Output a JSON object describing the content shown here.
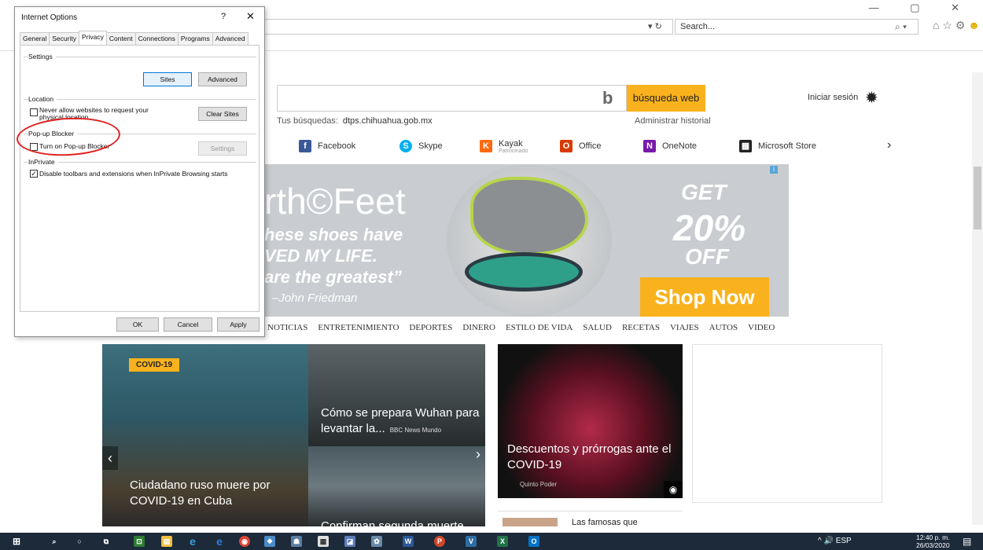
{
  "browser": {
    "search_placeholder": "Search...",
    "addr_tools": "▾ ↻",
    "window_controls": "— ▢ ✕"
  },
  "dialog": {
    "title": "Internet Options",
    "help": "?",
    "close": "✕",
    "tabs": [
      "General",
      "Security",
      "Privacy",
      "Content",
      "Connections",
      "Programs",
      "Advanced"
    ],
    "active_tab": "Privacy",
    "settings_label": "Settings",
    "sites_button": "Sites",
    "advanced_button": "Advanced",
    "location_label": "Location",
    "location_checkbox": "Never allow websites to request your physical location",
    "location_checked": false,
    "clear_sites_button": "Clear Sites",
    "popup_label": "Pop-up Blocker",
    "popup_checkbox": "Turn on Pop-up Blocker",
    "popup_checked": false,
    "popup_settings_button": "Settings",
    "inprivate_label": "InPrivate",
    "inprivate_checkbox": "Disable toolbars and extensions when InPrivate Browsing starts",
    "inprivate_checked": true,
    "ok_button": "OK",
    "cancel_button": "Cancel",
    "apply_button": "Apply"
  },
  "bing": {
    "search_button": "búsqueda web",
    "sign_in": "Iniciar sesión",
    "recent_label": "Tus búsquedas:",
    "recent_query": "dtps.chihuahua.gob.mx",
    "history_link": "Administrar historial"
  },
  "quick_links": [
    {
      "label": "Facebook",
      "sub": "",
      "icon": "f",
      "color": "#3b5998"
    },
    {
      "label": "Skype",
      "sub": "",
      "icon": "S",
      "color": "#00aff0"
    },
    {
      "label": "Kayak",
      "sub": "Patrocinado",
      "icon": "K",
      "color": "#ff690f"
    },
    {
      "label": "Office",
      "sub": "",
      "icon": "O",
      "color": "#d83b01"
    },
    {
      "label": "OneNote",
      "sub": "",
      "icon": "N",
      "color": "#7719aa"
    },
    {
      "label": "Microsoft Store",
      "sub": "",
      "icon": "▦",
      "color": "#222222"
    }
  ],
  "ad": {
    "brand": "rth©Feet",
    "quote_line1": "hese shoes have",
    "quote_line2": "VED MY LIFE.",
    "quote_line3": "are the greatest”",
    "signature": "–John Friedman",
    "get": "GET",
    "percent": "20%",
    "off": "OFF",
    "shop": "Shop Now",
    "info": "i"
  },
  "categories": [
    "NOTICIAS",
    "ENTRETENIMIENTO",
    "DEPORTES",
    "DINERO",
    "ESTILO DE VIDA",
    "SALUD",
    "RECETAS",
    "VIAJES",
    "AUTOS",
    "VIDEO"
  ],
  "news": {
    "t1_badge": "COVID-19",
    "t1_caption": "Ciudadano ruso muere por COVID-19 en Cuba",
    "t2_caption": "Cómo se prepara Wuhan para levantar la...",
    "t2_source": "BBC News Mundo",
    "t3_caption": "Confirman segunda muerte",
    "t4_caption": "Descuentos y prórrogas ante el COVID-19",
    "t4_source": "Quinto Poder",
    "t6_caption": "Las famosas que"
  },
  "taskbar": {
    "lang": "ESP",
    "time": "12:40 p. m.",
    "date": "26/03/2020",
    "tray": "^ 🔊 ESP"
  }
}
